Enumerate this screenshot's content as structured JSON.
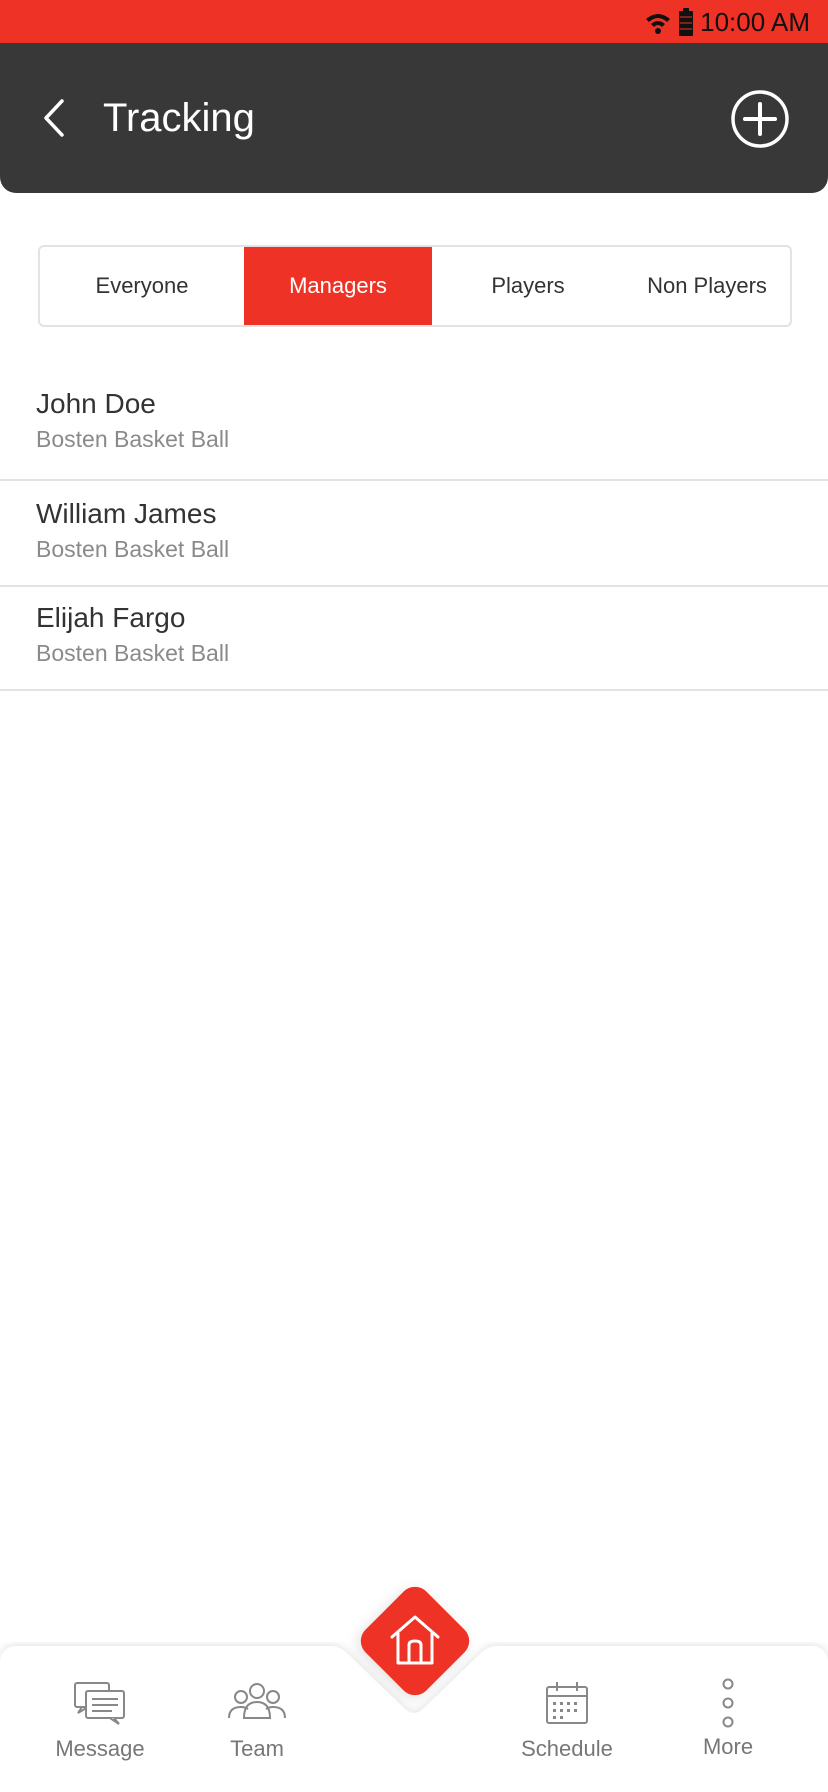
{
  "status_bar": {
    "time": "10:00 AM"
  },
  "header": {
    "title": "Tracking"
  },
  "segments": [
    {
      "label": "Everyone",
      "active": false
    },
    {
      "label": "Managers",
      "active": true
    },
    {
      "label": "Players",
      "active": false
    },
    {
      "label": "Non Players",
      "active": false
    }
  ],
  "people": [
    {
      "name": "John Doe",
      "team": "Bosten Basket Ball"
    },
    {
      "name": "William James",
      "team": "Bosten Basket Ball"
    },
    {
      "name": "Elijah Fargo",
      "team": "Bosten Basket Ball"
    }
  ],
  "bottom_nav": {
    "message": "Message",
    "team": "Team",
    "schedule": "Schedule",
    "more": "More"
  },
  "colors": {
    "accent": "#ee3326",
    "header_bg": "#383838"
  }
}
